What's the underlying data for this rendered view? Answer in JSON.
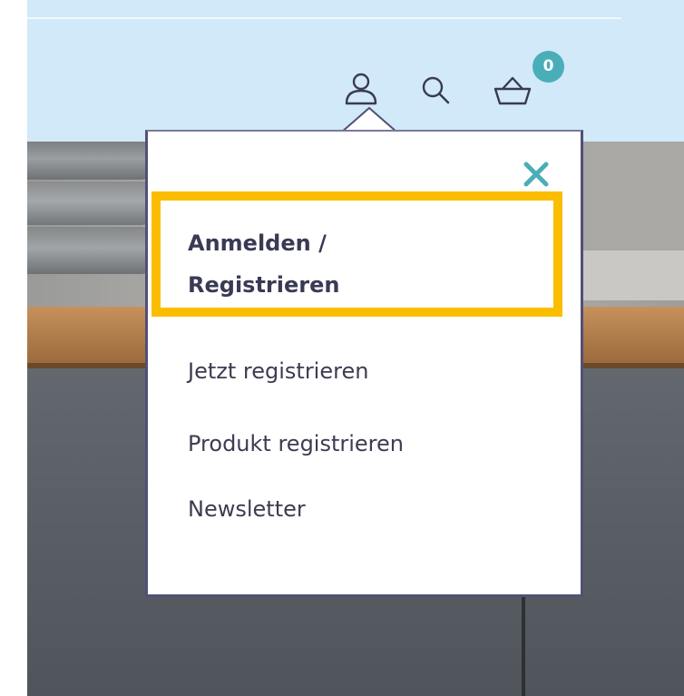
{
  "header": {
    "cart_count": "0",
    "icons": [
      "user-icon",
      "search-icon",
      "basket-icon"
    ]
  },
  "account_menu": {
    "close_icon": "close-icon",
    "login_register": "Anmelden / Registrieren",
    "items": [
      {
        "label": "Jetzt registrieren"
      },
      {
        "label": "Produkt registrieren"
      },
      {
        "label": "Newsletter"
      }
    ]
  },
  "colors": {
    "header_bg": "#d1e9f8",
    "badge": "#4aaeb9",
    "close": "#4aaeb9",
    "highlight": "#fbbd00",
    "dropdown_border": "#515077",
    "text": "#3c3c52"
  }
}
